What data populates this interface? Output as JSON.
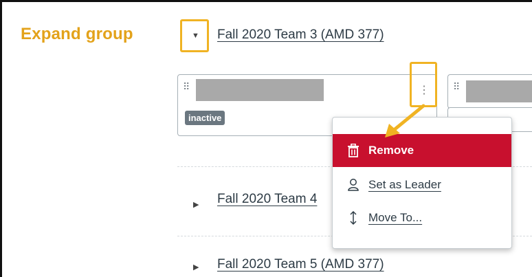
{
  "annotation": {
    "label": "Expand group",
    "color": "#f0b323"
  },
  "groups": [
    {
      "title": "Fall 2020 Team 3 (AMD 377)",
      "expanded": true
    },
    {
      "title": "Fall 2020 Team 4",
      "expanded": false
    },
    {
      "title": "Fall 2020 Team 5 (AMD 377)",
      "expanded": false
    }
  ],
  "member_card": {
    "status_badge": "inactive"
  },
  "context_menu": {
    "items": [
      {
        "label": "Remove",
        "icon": "trash-icon",
        "highlighted": true
      },
      {
        "label": "Set as Leader",
        "icon": "user-icon",
        "highlighted": false
      },
      {
        "label": "Move To...",
        "icon": "move-vertical-icon",
        "highlighted": false
      }
    ]
  },
  "colors": {
    "highlight": "#c8102e",
    "badge": "#6b7780",
    "annotation": "#f0b323"
  }
}
